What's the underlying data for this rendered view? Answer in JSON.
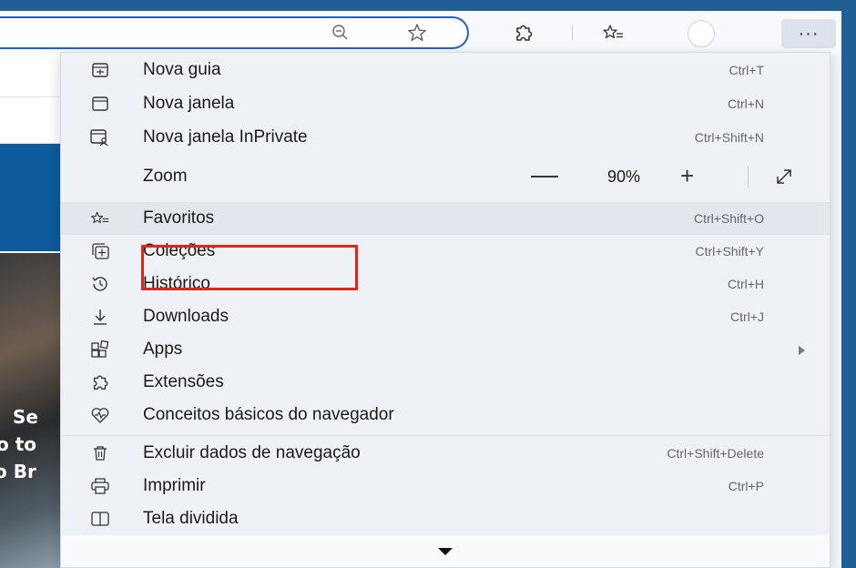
{
  "menu": {
    "items": [
      {
        "icon": "new-tab-icon",
        "label": "Nova guia",
        "shortcut": "Ctrl+T"
      },
      {
        "icon": "new-window-icon",
        "label": "Nova janela",
        "shortcut": "Ctrl+N"
      },
      {
        "icon": "inprivate-window-icon",
        "label": "Nova janela InPrivate",
        "shortcut": "Ctrl+Shift+N"
      },
      {
        "icon": "favorites-icon",
        "label": "Favoritos",
        "shortcut": "Ctrl+Shift+O"
      },
      {
        "icon": "collections-icon",
        "label": "Coleções",
        "shortcut": "Ctrl+Shift+Y"
      },
      {
        "icon": "history-icon",
        "label": "Histórico",
        "shortcut": "Ctrl+H"
      },
      {
        "icon": "downloads-icon",
        "label": "Downloads",
        "shortcut": "Ctrl+J"
      },
      {
        "icon": "apps-icon",
        "label": "Apps",
        "shortcut": ""
      },
      {
        "icon": "extensions-icon",
        "label": "Extensões",
        "shortcut": ""
      },
      {
        "icon": "browser-essentials-icon",
        "label": "Conceitos básicos do navegador",
        "shortcut": ""
      },
      {
        "icon": "delete-browsing-data-icon",
        "label": "Excluir dados de navegação",
        "shortcut": "Ctrl+Shift+Delete"
      },
      {
        "icon": "print-icon",
        "label": "Imprimir",
        "shortcut": "Ctrl+P"
      },
      {
        "icon": "split-screen-icon",
        "label": "Tela dividida",
        "shortcut": ""
      }
    ],
    "zoom": {
      "label": "Zoom",
      "value": "90%",
      "minus": "—",
      "plus": "+"
    },
    "highlighted": "Favoritos"
  },
  "toolbar": {
    "more_label": "···",
    "icons": [
      "zoom-out-icon",
      "favorite-star-icon",
      "extensions-icon",
      "favorites-icon",
      "profile-icon",
      "more-icon"
    ]
  },
  "page": {
    "photo_text": [
      "Se",
      "o to",
      "o Br"
    ]
  },
  "colors": {
    "accent": "#1e62c7",
    "highlight_box": "#e0251b",
    "page_blue": "#0e5a9c"
  }
}
